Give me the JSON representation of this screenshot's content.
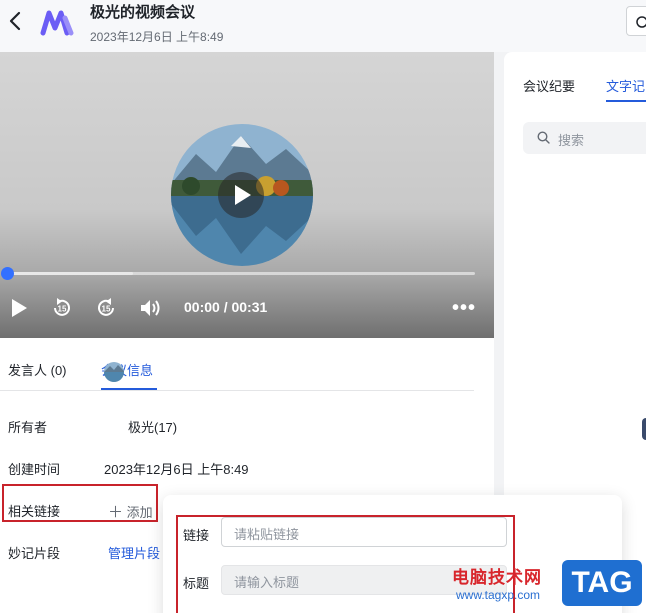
{
  "header": {
    "title": "极光的视频会议",
    "date": "2023年12月6日 上午8:49"
  },
  "player": {
    "time": "00:00 / 00:31",
    "progress": 0.27
  },
  "tabs": [
    {
      "label": "发言人 (0)"
    },
    {
      "label": "会议信息"
    }
  ],
  "info": {
    "owner_label": "所有者",
    "owner_value": "极光(17)",
    "created_label": "创建时间",
    "created_value": "2023年12月6日 上午8:49",
    "links_label": "相关链接",
    "add_label": "添加",
    "clips_label": "妙记片段",
    "manage_label": "管理片段"
  },
  "right_panel": {
    "tabs": [
      {
        "label": "会议纪要"
      },
      {
        "label": "文字记"
      }
    ],
    "search_placeholder": "搜索"
  },
  "popup": {
    "link_label": "链接",
    "link_placeholder": "请粘贴链接",
    "title_label": "标题",
    "title_placeholder": "请输入标题"
  },
  "watermark": {
    "site": "电脑技术网",
    "url": "www.tagxp.com",
    "tag": "TAG"
  },
  "colors": {
    "accent": "#245bdb",
    "highlight_box": "#c8232b"
  }
}
